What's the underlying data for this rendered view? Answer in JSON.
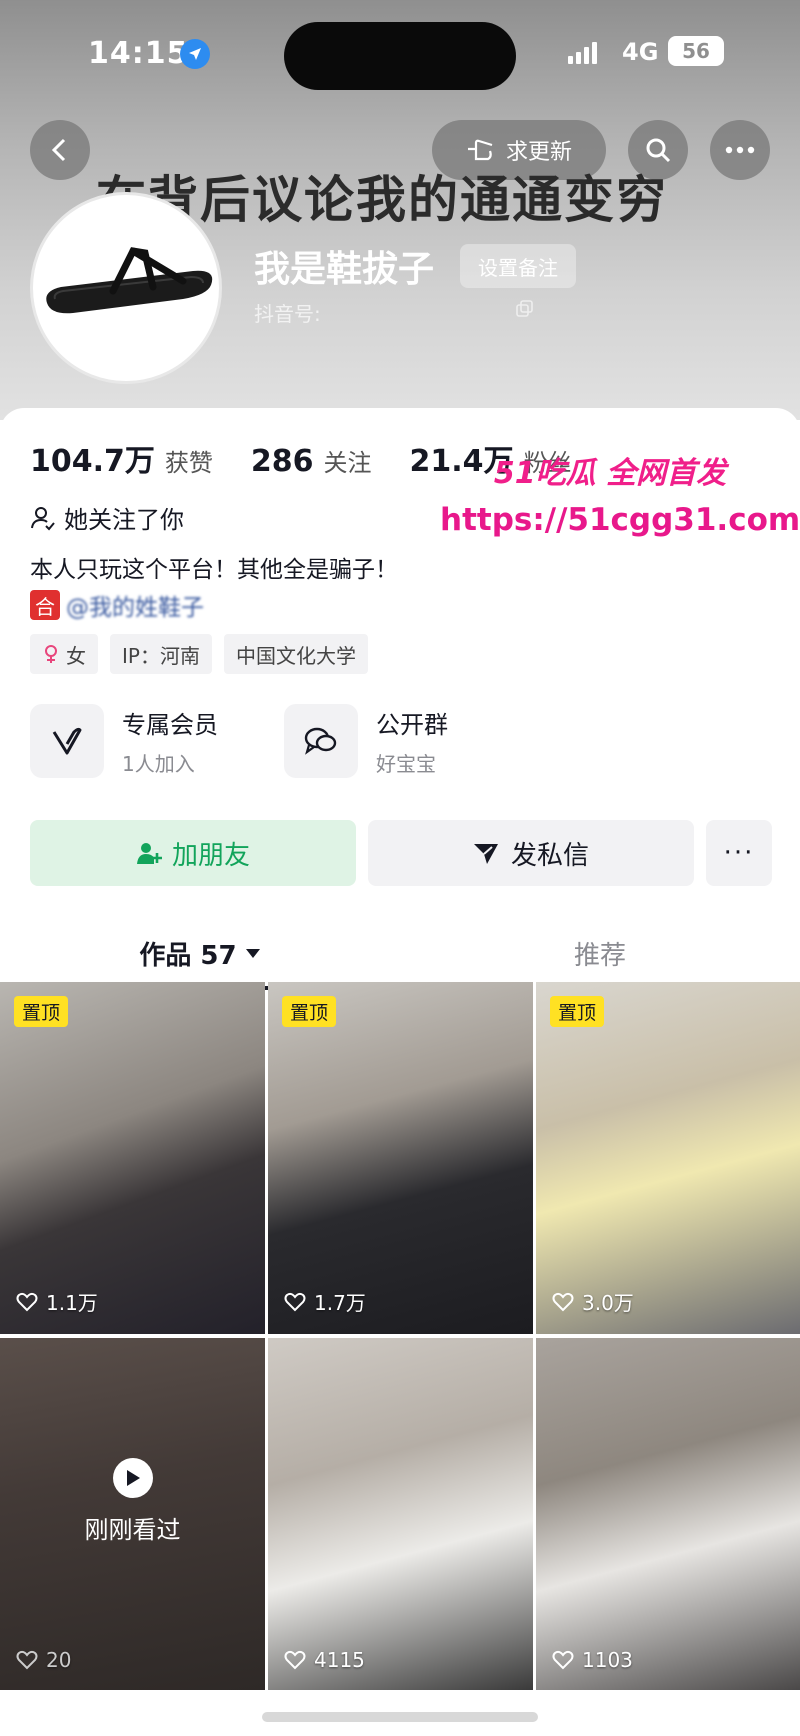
{
  "status_bar": {
    "time": "14:15",
    "network": "4G",
    "battery": "56"
  },
  "header": {
    "back_icon": "chevron-left-icon",
    "request_update_label": "求更新",
    "search_icon": "search-icon",
    "more_icon": "more-icon",
    "banner_text": "在背后议论我的通通变穷",
    "nickname": "我是鞋拔子",
    "set_remark_label": "设置备注",
    "douyin_id_label": "抖音号:"
  },
  "stats": [
    {
      "value": "104.7万",
      "label": "获赞"
    },
    {
      "value": "286",
      "label": "关注"
    },
    {
      "value": "21.4万",
      "label": "粉丝"
    }
  ],
  "profile": {
    "follows_you": "她关注了你",
    "bio": "本人只玩这个平台！其他全是骗子！",
    "mention_badge": "合",
    "mention_text": "@我的姓鞋子"
  },
  "watermark": {
    "title": "51吃瓜 全网首发",
    "url": "https://51cgg31.com"
  },
  "tags": [
    {
      "icon": "female-icon",
      "label": "女"
    },
    {
      "label": "IP：河南"
    },
    {
      "label": "中国文化大学"
    }
  ],
  "features": [
    {
      "title": "专属会员",
      "subtitle": "1人加入",
      "icon": "vip-icon"
    },
    {
      "title": "公开群",
      "subtitle": "好宝宝",
      "icon": "chat-group-icon"
    }
  ],
  "actions": {
    "add_friend": "加朋友",
    "message": "发私信",
    "more": "···"
  },
  "tabs": [
    {
      "label": "作品 57"
    },
    {
      "label": "推荐"
    }
  ],
  "videos": [
    {
      "pinned": "置顶",
      "likes": "1.1万",
      "watched": ""
    },
    {
      "pinned": "置顶",
      "likes": "1.7万",
      "watched": ""
    },
    {
      "pinned": "置顶",
      "likes": "3.0万",
      "watched": ""
    },
    {
      "pinned": "",
      "likes": "20",
      "watched": "刚刚看过"
    },
    {
      "pinned": "",
      "likes": "4115",
      "watched": ""
    },
    {
      "pinned": "",
      "likes": "1103",
      "watched": ""
    }
  ],
  "colors": {
    "accent_green": "#12a45b",
    "pin_yellow": "#ffe123",
    "watermark_pink": "#e8188b"
  }
}
